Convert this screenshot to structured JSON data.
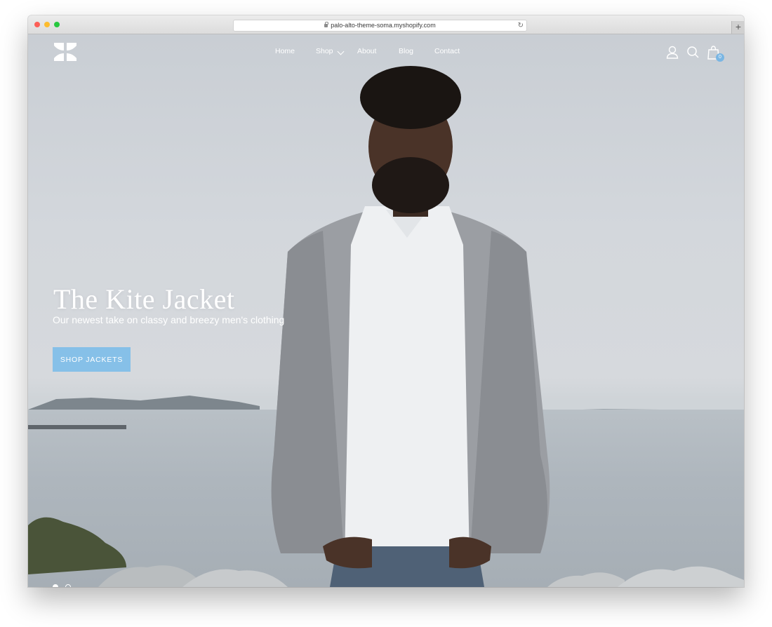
{
  "browser": {
    "url": "palo-alto-theme-soma.myshopify.com",
    "new_tab": "+"
  },
  "nav": {
    "items": [
      {
        "label": "Home"
      },
      {
        "label": "Shop"
      },
      {
        "label": "About"
      },
      {
        "label": "Blog"
      },
      {
        "label": "Contact"
      }
    ]
  },
  "header_icons": {
    "account": "user-icon",
    "search": "search-icon",
    "cart": "shopping-bag-icon",
    "cart_count": "0"
  },
  "hero": {
    "title": "The Kite Jacket",
    "subtitle": "Our newest take on classy and breezy men's clothing",
    "cta_label": "SHOP JACKETS",
    "slides_total": 2,
    "slide_active": 1
  },
  "colors": {
    "accent": "#86c0e8",
    "badge": "#7ab6e3"
  }
}
